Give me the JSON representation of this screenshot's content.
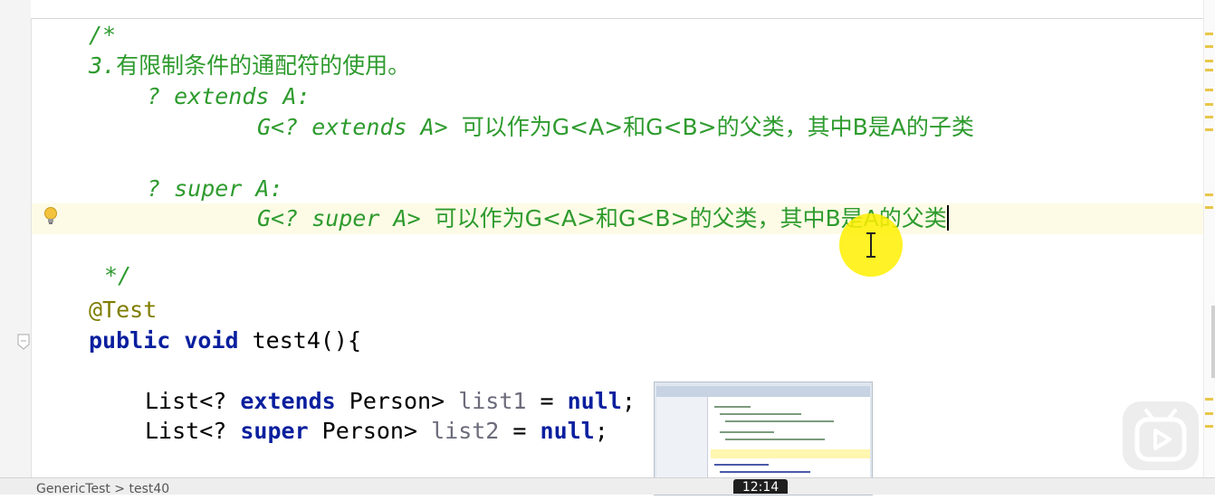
{
  "editor": {
    "lines": [
      {
        "id": "c1",
        "segments": [
          {
            "text": "/*",
            "cls": "comment"
          }
        ]
      },
      {
        "id": "c2",
        "segments": [
          {
            "text": "3.",
            "cls": "comment"
          },
          {
            "text": "有限制条件的通配符的使用。",
            "cls": "comment cj"
          }
        ]
      },
      {
        "id": "c3",
        "segments": [
          {
            "text": "? extends A:",
            "cls": "comment"
          }
        ]
      },
      {
        "id": "c4",
        "segments": [
          {
            "text": "G<? extends A> ",
            "cls": "comment"
          },
          {
            "text": "可以作为G<A>和G<B>的父类，其中B是A的子类",
            "cls": "comment cj"
          }
        ]
      },
      {
        "id": "c5",
        "segments": [
          {
            "text": "? super A:",
            "cls": "comment"
          }
        ]
      },
      {
        "id": "c6",
        "segments": [
          {
            "text": "G<? super A> ",
            "cls": "comment"
          },
          {
            "text": "可以作为G<A>和G<B>的父类，其中B是A的父类",
            "cls": "comment cj"
          }
        ]
      },
      {
        "id": "c7",
        "segments": [
          {
            "text": "*/",
            "cls": "comment"
          }
        ]
      },
      {
        "id": "a1",
        "segments": [
          {
            "text": "@Test",
            "cls": "ann"
          }
        ]
      },
      {
        "id": "m1",
        "segments": [
          {
            "text": "public void ",
            "cls": "kw"
          },
          {
            "text": "test4(){",
            "cls": "plain"
          }
        ]
      },
      {
        "id": "s1",
        "segments": [
          {
            "text": "List<? ",
            "cls": "plain"
          },
          {
            "text": "extends ",
            "cls": "kw"
          },
          {
            "text": "Person> ",
            "cls": "plain"
          },
          {
            "text": "list1",
            "cls": "gray"
          },
          {
            "text": " = ",
            "cls": "plain"
          },
          {
            "text": "null",
            "cls": "kw"
          },
          {
            "text": ";",
            "cls": "plain"
          }
        ]
      },
      {
        "id": "s2",
        "segments": [
          {
            "text": "List<? ",
            "cls": "plain"
          },
          {
            "text": "super ",
            "cls": "kw"
          },
          {
            "text": "Person> ",
            "cls": "plain"
          },
          {
            "text": "list2",
            "cls": "gray"
          },
          {
            "text": " = ",
            "cls": "plain"
          },
          {
            "text": "null",
            "cls": "kw"
          },
          {
            "text": ";",
            "cls": "plain"
          }
        ]
      }
    ]
  },
  "statusbar": {
    "breadcrumb": "GenericTest  >  test40"
  },
  "video": {
    "timestamp": "12:14",
    "play_icon": "play-icon"
  },
  "icons": {
    "intention": "lightbulb-icon",
    "fold": "fold-marker-icon"
  },
  "colors": {
    "comment": "#2e9b2e",
    "keyword": "#0a1f9e",
    "annotation": "#7f7d00",
    "current_line": "#fdfbe6",
    "cursor_highlight": "#fff000"
  }
}
